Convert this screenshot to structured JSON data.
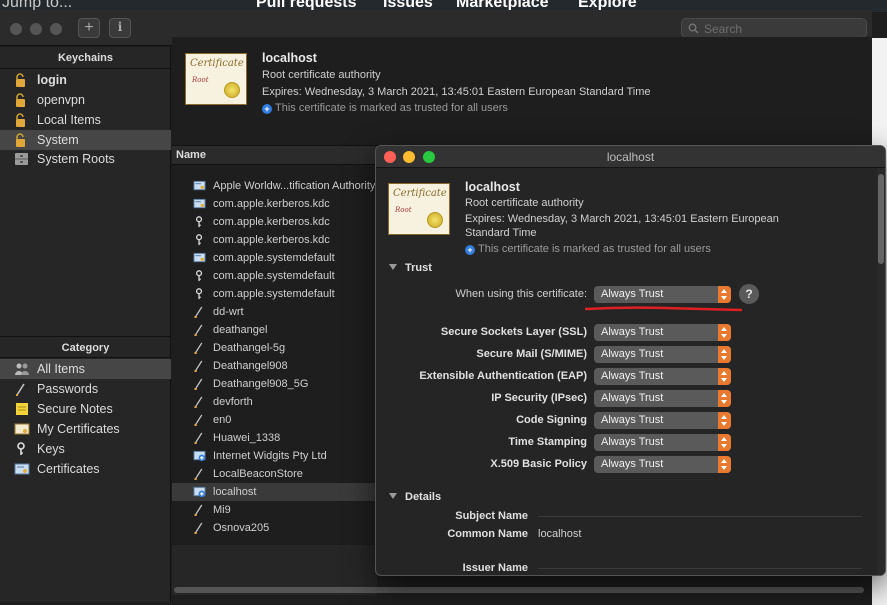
{
  "background": {
    "jump_to": "Jump to...",
    "nav": [
      "Pull requests",
      "Issues",
      "Marketplace",
      "Explore"
    ]
  },
  "toolbar": {
    "add_label": "+",
    "info_label": "i",
    "search_placeholder": "Search"
  },
  "sidebar": {
    "keychains_header": "Keychains",
    "keychains": [
      {
        "label": "login",
        "icon": "lock-open-icon"
      },
      {
        "label": "openvpn",
        "icon": "lock-open-icon"
      },
      {
        "label": "Local Items",
        "icon": "lock-open-icon"
      },
      {
        "label": "System",
        "icon": "lock-open-icon",
        "selected": true
      },
      {
        "label": "System Roots",
        "icon": "cabinet-icon"
      }
    ],
    "category_header": "Category",
    "categories": [
      {
        "label": "All Items",
        "icon": "people-icon",
        "selected": true
      },
      {
        "label": "Passwords",
        "icon": "pencil-icon"
      },
      {
        "label": "Secure Notes",
        "icon": "note-icon"
      },
      {
        "label": "My Certificates",
        "icon": "certificate-icon"
      },
      {
        "label": "Keys",
        "icon": "key-icon"
      },
      {
        "label": "Certificates",
        "icon": "certificate-icon"
      }
    ]
  },
  "detail": {
    "name": "localhost",
    "type": "Root certificate authority",
    "expires": "Expires: Wednesday, 3 March 2021, 13:45:01 Eastern European Standard Time",
    "trusted_note": "This certificate is marked as trusted for all users",
    "cert_caption": "Certificate",
    "cert_sub": "Root"
  },
  "list": {
    "header": "Name",
    "rows": [
      {
        "name": "Apple Worldw...tification Authority",
        "icon": "certificate-icon"
      },
      {
        "name": "com.apple.kerberos.kdc",
        "icon": "certificate-icon"
      },
      {
        "name": "com.apple.kerberos.kdc",
        "icon": "key-icon"
      },
      {
        "name": "com.apple.kerberos.kdc",
        "icon": "key-icon"
      },
      {
        "name": "com.apple.systemdefault",
        "icon": "certificate-icon"
      },
      {
        "name": "com.apple.systemdefault",
        "icon": "key-icon"
      },
      {
        "name": "com.apple.systemdefault",
        "icon": "key-icon"
      },
      {
        "name": "dd-wrt",
        "icon": "pencil-icon"
      },
      {
        "name": "deathangel",
        "icon": "pencil-icon"
      },
      {
        "name": "Deathangel-5g",
        "icon": "pencil-icon"
      },
      {
        "name": "Deathangel908",
        "icon": "pencil-icon"
      },
      {
        "name": "Deathangel908_5G",
        "icon": "pencil-icon"
      },
      {
        "name": "devforth",
        "icon": "pencil-icon"
      },
      {
        "name": "en0",
        "icon": "pencil-icon"
      },
      {
        "name": "Huawei_1338",
        "icon": "pencil-icon"
      },
      {
        "name": "Internet Widgits Pty Ltd",
        "icon": "certificate-plus-icon"
      },
      {
        "name": "LocalBeaconStore",
        "icon": "pencil-icon"
      },
      {
        "name": "localhost",
        "icon": "certificate-plus-icon",
        "selected": true
      },
      {
        "name": "Mi9",
        "icon": "pencil-icon"
      },
      {
        "name": "Osnova205",
        "icon": "pencil-icon"
      }
    ]
  },
  "popup": {
    "title": "localhost",
    "name": "localhost",
    "type": "Root certificate authority",
    "expires_line1": "Expires: Wednesday, 3 March 2021, 13:45:01 Eastern European",
    "expires_line2": "Standard Time",
    "trusted_note": "This certificate is marked as trusted for all users",
    "trust_section": "Trust",
    "when_using_label": "When using this certificate:",
    "when_using_value": "Always Trust",
    "help_label": "?",
    "policies": [
      {
        "label": "Secure Sockets Layer (SSL)",
        "value": "Always Trust"
      },
      {
        "label": "Secure Mail (S/MIME)",
        "value": "Always Trust"
      },
      {
        "label": "Extensible Authentication (EAP)",
        "value": "Always Trust"
      },
      {
        "label": "IP Security (IPsec)",
        "value": "Always Trust"
      },
      {
        "label": "Code Signing",
        "value": "Always Trust"
      },
      {
        "label": "Time Stamping",
        "value": "Always Trust"
      },
      {
        "label": "X.509 Basic Policy",
        "value": "Always Trust"
      }
    ],
    "details_section": "Details",
    "subject_name_label": "Subject Name",
    "common_name_label": "Common Name",
    "common_name_value": "localhost",
    "issuer_name_label": "Issuer Name"
  },
  "colors": {
    "accent_orange": "#e8792e",
    "annotation_red": "#e02020",
    "info_blue": "#2f7bde"
  }
}
